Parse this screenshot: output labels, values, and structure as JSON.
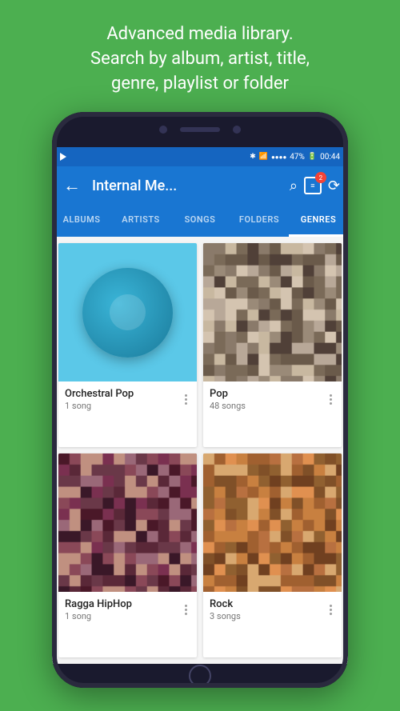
{
  "header": {
    "title": "Advanced media library.\nSearch by album, artist, title,\ngenre, playlist or folder"
  },
  "status_bar": {
    "time": "00:44",
    "battery": "47%",
    "signal": "●●●●"
  },
  "app_bar": {
    "back_label": "←",
    "title": "Internal Me...",
    "search_label": "⌕",
    "queue_count": "2",
    "sync_label": "⟳"
  },
  "tabs": [
    {
      "label": "ALBUMS",
      "active": false
    },
    {
      "label": "ARTISTS",
      "active": false
    },
    {
      "label": "SONGS",
      "active": false
    },
    {
      "label": "FOLDERS",
      "active": false
    },
    {
      "label": "GENRES",
      "active": true
    }
  ],
  "genres": [
    {
      "name": "Orchestral Pop",
      "count": "1 song",
      "art_type": "orchestral"
    },
    {
      "name": "Pop",
      "count": "48 songs",
      "art_type": "pop"
    },
    {
      "name": "Ragga HipHop",
      "count": "1 song",
      "art_type": "ragga"
    },
    {
      "name": "Rock",
      "count": "3 songs",
      "art_type": "rock"
    }
  ],
  "more_icon": "⋮",
  "colors": {
    "green_bg": "#4CAF50",
    "blue_primary": "#1976d2",
    "blue_dark": "#1565c0"
  }
}
